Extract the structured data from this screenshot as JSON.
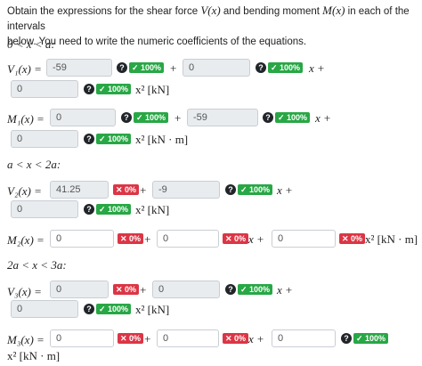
{
  "intro": {
    "line1a": "Obtain the expressions for the shear force ",
    "V": "V(x)",
    "line1b": " and bending moment ",
    "M": "M(x)",
    "line1c": " in each of the intervals",
    "line2": "below. You need to write the numeric coefficients of the equations."
  },
  "intervals": [
    "0 < x < a:",
    "a < x < 2a:",
    "2a < x < 3a:"
  ],
  "labels": {
    "v1": "V₁(x) =",
    "m1": "M₁(x) =",
    "v2": "V₂(x) =",
    "m2": "M₂(x) =",
    "v3": "V₃(x) =",
    "m3": "M₃(x) ="
  },
  "values": {
    "v1a": "-59",
    "v1b": "0",
    "v1c": "0",
    "m1a": "0",
    "m1b": "-59",
    "m1c": "0",
    "v2a": "41.25",
    "v2b": "-9",
    "v2c": "0",
    "m2a": "0",
    "m2b": "0",
    "m2c": "0",
    "v3a": "0",
    "v3b": "0",
    "v3c": "0",
    "m3a": "0",
    "m3b": "0",
    "m3c": "0"
  },
  "badges": {
    "correct": "✓ 100%",
    "wrong": "✕ 0%",
    "help": "?"
  },
  "ops": {
    "plus": "+",
    "x_plus": "x +"
  },
  "units": {
    "x2_kN": "x² [kN]",
    "x2_kNm": "x² [kN · m]",
    "kNm": "[kN · m]"
  }
}
